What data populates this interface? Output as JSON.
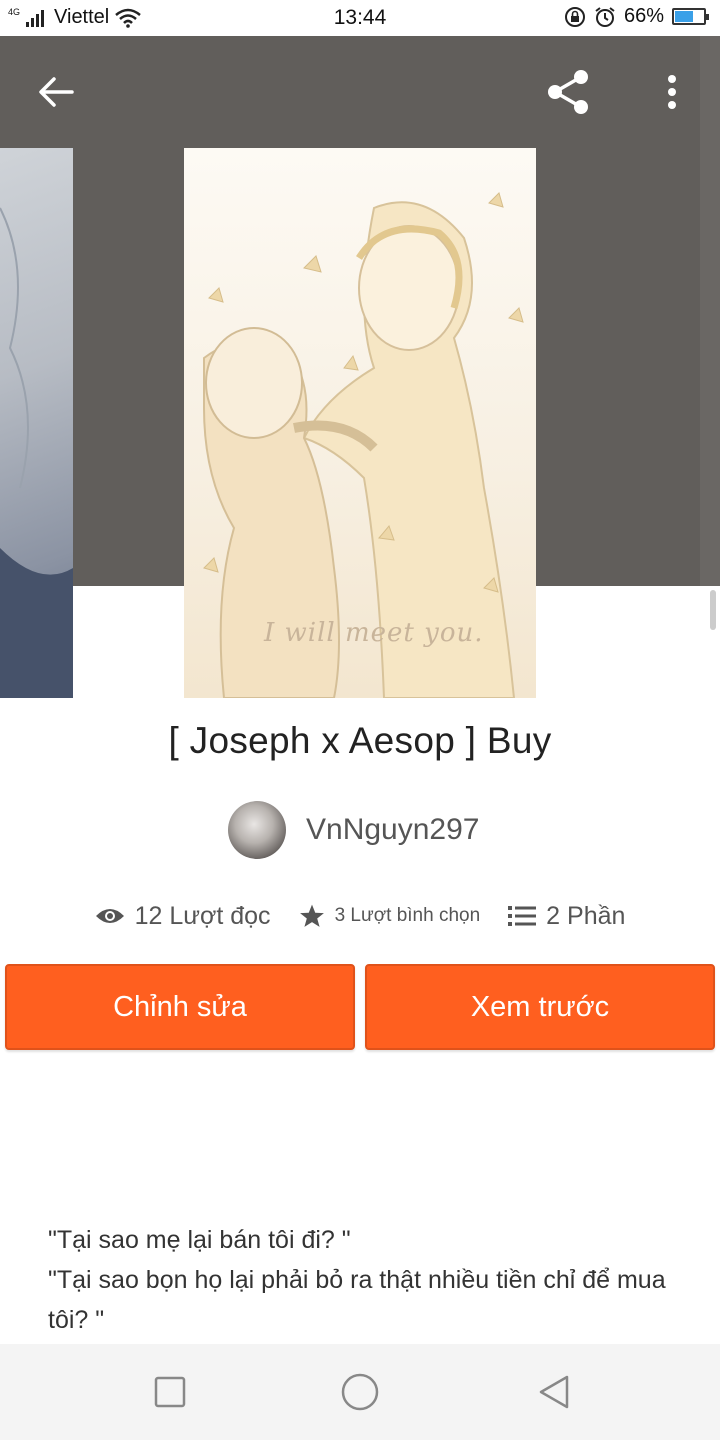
{
  "status_bar": {
    "network": "4G",
    "carrier": "Viettel",
    "time": "13:44",
    "battery_percent": "66%",
    "battery_level": 0.66
  },
  "story": {
    "title": "[ Joseph x Aesop ] Buy",
    "author": "VnNguyn297",
    "cover_caption": "I will meet you."
  },
  "stats": {
    "reads": "12 Lượt đọc",
    "votes": "3 Lượt bình chọn",
    "parts": "2 Phần"
  },
  "actions": {
    "edit_label": "Chỉnh sửa",
    "preview_label": "Xem trước"
  },
  "description": {
    "line1": "\"Tại sao mẹ lại bán tôi đi? \"",
    "line2": "\"Tại sao bọn họ lại phải bỏ ra thật nhiều tiền chỉ để mua tôi? \""
  },
  "colors": {
    "accent": "#ff5f1f",
    "header_bg": "#615e5b"
  },
  "icons": {
    "back": "arrow-left-icon",
    "share": "share-icon",
    "more": "more-vertical-icon",
    "reads": "eye-icon",
    "votes": "star-icon",
    "parts": "list-icon"
  }
}
